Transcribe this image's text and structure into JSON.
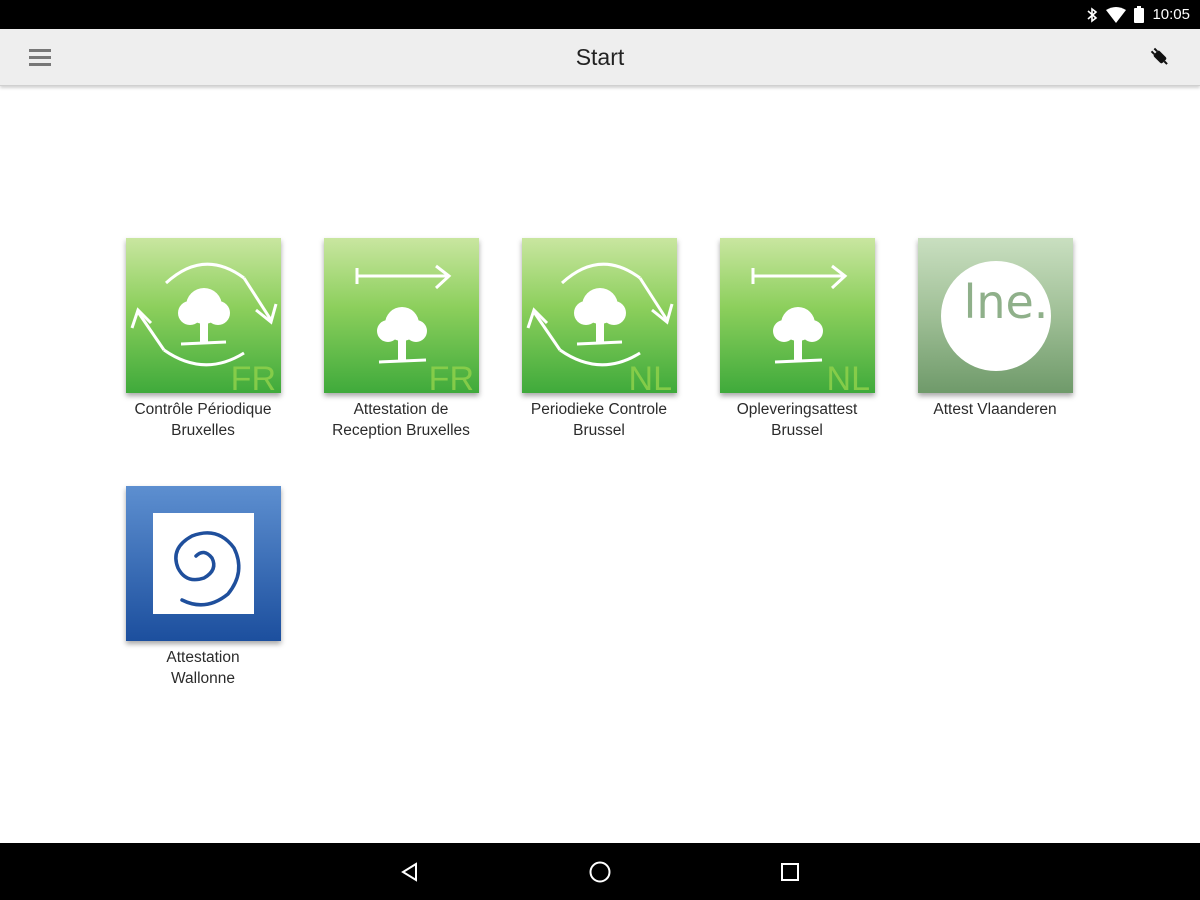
{
  "status_bar": {
    "time": "10:05",
    "icons": [
      "bluetooth-icon",
      "wifi-icon",
      "battery-icon"
    ]
  },
  "app_bar": {
    "title": "Start",
    "menu_icon": "hamburger-menu-icon",
    "action_icon": "tool-icon"
  },
  "tiles": [
    {
      "line1": "Contrôle Périodique",
      "line2": "Bruxelles",
      "badge": "FR",
      "icon": "cycle-tree-icon",
      "color": "#5fb83e"
    },
    {
      "line1": "Attestation de",
      "line2": "Reception Bruxelles",
      "badge": "FR",
      "icon": "arrow-tree-icon",
      "color": "#5fb83e"
    },
    {
      "line1": "Periodieke Controle",
      "line2": "Brussel",
      "badge": "NL",
      "icon": "cycle-tree-icon",
      "color": "#5fb83e"
    },
    {
      "line1": "Opleveringsattest",
      "line2": "Brussel",
      "badge": "NL",
      "icon": "arrow-tree-icon",
      "color": "#5fb83e"
    },
    {
      "line1": "Attest Vlaanderen",
      "line2": "",
      "badge": "lne.",
      "icon": "lne-logo-icon",
      "color": "#7fa37a"
    },
    {
      "line1": "Attestation",
      "line2": "Wallonne",
      "badge": "",
      "icon": "spiral-logo-icon",
      "color": "#1f5aa8"
    }
  ],
  "nav_bar": {
    "back_icon": "back-triangle-icon",
    "home_icon": "home-circle-icon",
    "recents_icon": "recents-square-icon"
  }
}
